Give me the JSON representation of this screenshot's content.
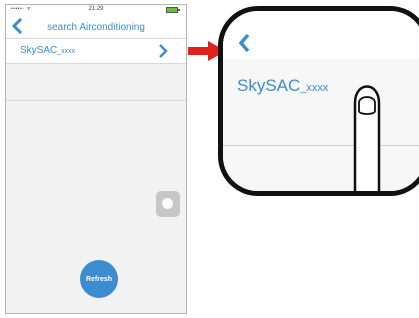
{
  "phone": {
    "status": {
      "carrier": "•••••◦ ᯤ",
      "time": "21:29"
    },
    "nav": {
      "title": "search Airconditioning"
    },
    "devices": [
      {
        "name": "SkySAC",
        "suffix": "_xxxx"
      }
    ],
    "refresh_label": "Refresh"
  },
  "zoom": {
    "item": {
      "name": "SkySAC",
      "suffix": "_xxxx"
    }
  },
  "colors": {
    "accent": "#3d8ccf",
    "arrow": "#e0221b",
    "background": "#f2f2f2"
  },
  "icons": [
    "back-chevron-icon",
    "chevron-right-icon",
    "battery-icon",
    "assistive-touch-icon",
    "pointing-finger-icon",
    "red-arrow-icon"
  ]
}
